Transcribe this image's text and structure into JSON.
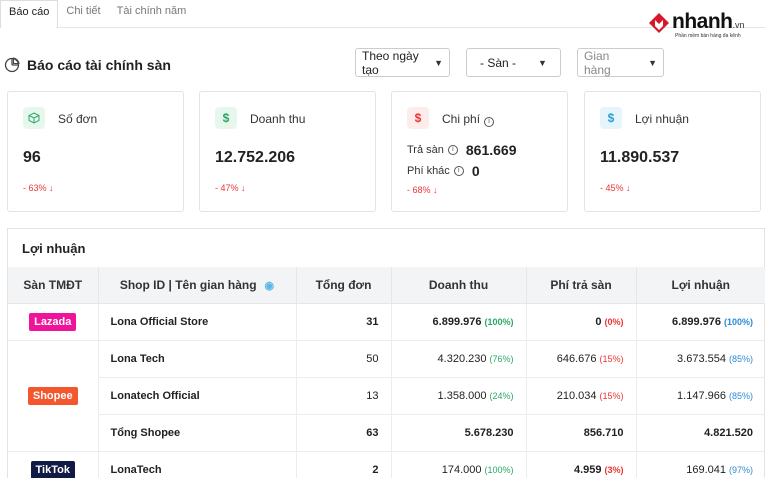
{
  "tabs": [
    {
      "label": "Báo cáo",
      "active": true
    },
    {
      "label": "Chi tiết",
      "active": false
    },
    {
      "label": "Tài chính năm",
      "active": false
    }
  ],
  "logo": {
    "brand": "nhanh",
    "tld": ".vn",
    "slogan": "Phần mềm bán hàng đa kênh",
    "icon": "nhanh-logo-icon"
  },
  "header": {
    "title": "Báo cáo tài chính sàn",
    "icon": "pie-chart-icon"
  },
  "filters": {
    "date": "Theo ngày tạo",
    "platform": "- Sàn -",
    "store": "Gian hàng"
  },
  "cards": {
    "orders": {
      "label": "Số đơn",
      "value": "96",
      "delta": "- 63%",
      "icon": "cube-icon",
      "color": "#2aa866",
      "bg": "#e8f7ee"
    },
    "revenue": {
      "label": "Doanh thu",
      "value": "12.752.206",
      "delta": "- 47%",
      "icon": "dollar-icon",
      "color": "#2aa866",
      "bg": "#e8f7ee"
    },
    "cost": {
      "label": "Chi phí",
      "sub1_label": "Trả sàn",
      "sub1_value": "861.669",
      "sub2_label": "Phí khác",
      "sub2_value": "0",
      "delta": "- 68%",
      "icon": "dollar-icon",
      "color": "#e33",
      "bg": "#fdecec"
    },
    "profit": {
      "label": "Lợi nhuận",
      "value": "11.890.537",
      "delta": "- 45%",
      "icon": "dollar-icon",
      "color": "#2b9fd6",
      "bg": "#e6f4fb"
    }
  },
  "profit_table": {
    "title": "Lợi nhuận",
    "headers": {
      "platform": "Sàn TMĐT",
      "shop": "Shop ID | Tên gian hàng",
      "orders": "Tổng đơn",
      "revenue": "Doanh thu",
      "fee": "Phí trả sàn",
      "profit": "Lợi nhuận"
    },
    "platforms": {
      "lazada": {
        "label": "Lazada",
        "color": "#f0149b"
      },
      "shopee": {
        "label": "Shopee",
        "color": "#f4572e"
      },
      "tiktok": {
        "label": "TikTok",
        "color": "#111a44"
      }
    },
    "rows": [
      {
        "shop": "Lona Official Store",
        "orders": "31",
        "revenue": "6.899.976",
        "revenue_pct": "(100%)",
        "fee": "0",
        "fee_pct": "(0%)",
        "profit": "6.899.976",
        "profit_pct": "(100%)"
      },
      {
        "shop": "Lona Tech",
        "orders": "50",
        "revenue": "4.320.230",
        "revenue_pct": "(76%)",
        "fee": "646.676",
        "fee_pct": "(15%)",
        "profit": "3.673.554",
        "profit_pct": "(85%)"
      },
      {
        "shop": "Lonatech Official",
        "orders": "13",
        "revenue": "1.358.000",
        "revenue_pct": "(24%)",
        "fee": "210.034",
        "fee_pct": "(15%)",
        "profit": "1.147.966",
        "profit_pct": "(85%)"
      },
      {
        "shop": "Tổng Shopee",
        "orders": "63",
        "revenue": "5.678.230",
        "fee": "856.710",
        "profit": "4.821.520"
      },
      {
        "shop": "LonaTech",
        "orders": "2",
        "revenue": "174.000",
        "revenue_pct": "(100%)",
        "fee": "4.959",
        "fee_pct": "(3%)",
        "profit": "169.041",
        "profit_pct": "(97%)"
      }
    ]
  }
}
